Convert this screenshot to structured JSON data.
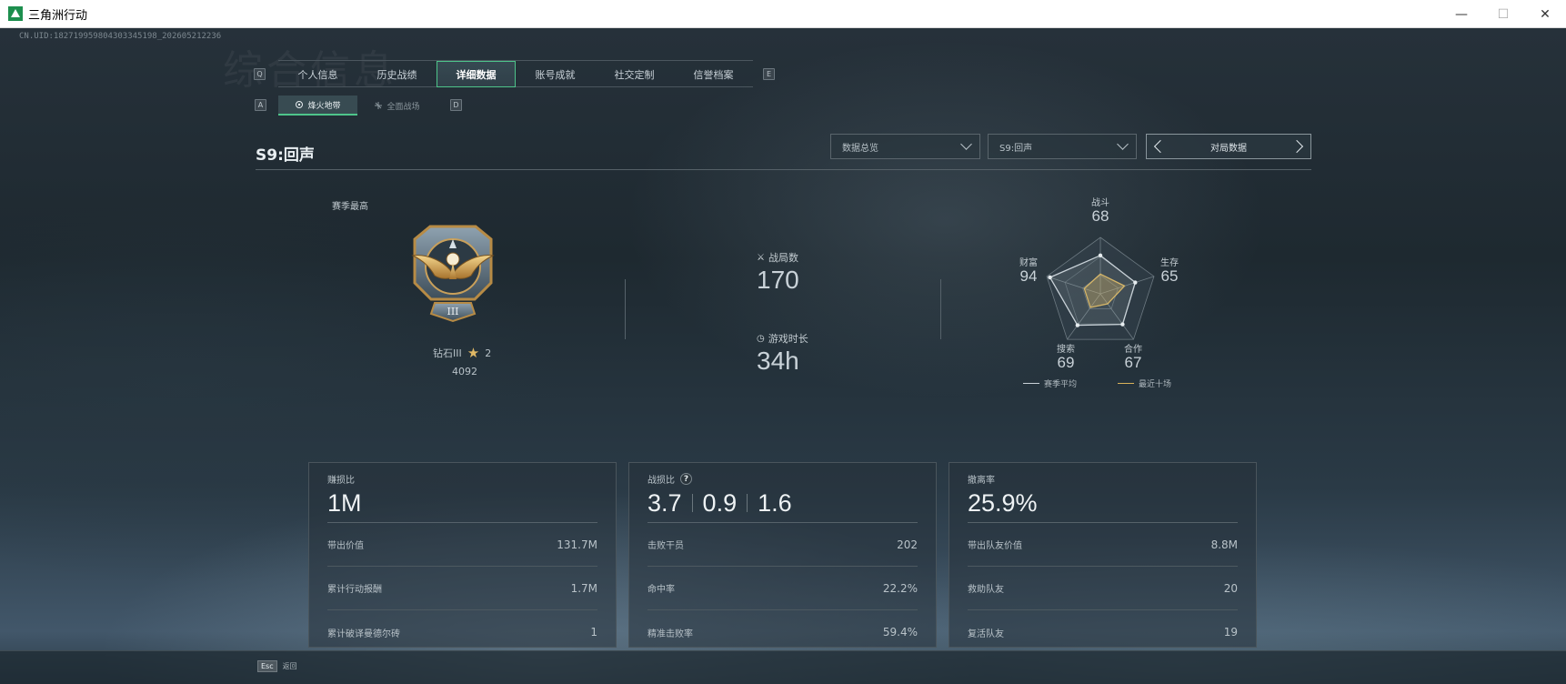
{
  "window": {
    "title": "三角洲行动",
    "minimize": "—",
    "maximize": "☐",
    "close": "✕"
  },
  "uid": "CN.UID:1827199598043033451​98_202605212236",
  "bg_text": "综合信息",
  "tabs": {
    "key_left": "Q",
    "key_right": "E",
    "items": [
      "个人信息",
      "历史战绩",
      "详细数据",
      "账号成就",
      "社交定制",
      "信誉档案"
    ],
    "active": "详细数据"
  },
  "subtabs": {
    "key_left": "A",
    "key_right": "D",
    "items": [
      {
        "label": "烽火地带",
        "icon": "fire-zone-icon"
      },
      {
        "label": "全面战场",
        "icon": "battlefield-icon"
      }
    ],
    "active": "烽火地带"
  },
  "season_title": "S9:回声",
  "dropdowns": {
    "overview": "数据总览",
    "season": "S9:回声"
  },
  "match_nav": {
    "label": "对局数据"
  },
  "rank": {
    "label": "赛季最高",
    "name": "钻石III",
    "stars": "2",
    "points": "4092",
    "badge_numeral": "III"
  },
  "stats": {
    "matches_label": "战局数",
    "matches_value": "170",
    "playtime_label": "游戏时长",
    "playtime_value": "34h"
  },
  "radar": {
    "axes": [
      {
        "label": "战斗",
        "value": "68"
      },
      {
        "label": "生存",
        "value": "65"
      },
      {
        "label": "合作",
        "value": "67"
      },
      {
        "label": "搜索",
        "value": "69"
      },
      {
        "label": "财富",
        "value": "94"
      }
    ],
    "legend_avg": "赛季平均",
    "legend_recent": "最近十场",
    "color_avg": "#c9d2d8",
    "color_recent": "#d9b25a"
  },
  "cards": [
    {
      "title": "赚损比",
      "big": [
        "1M"
      ],
      "rows": [
        {
          "label": "带出价值",
          "value": "131.7M"
        },
        {
          "label": "累计行动报酬",
          "value": "1.7M"
        },
        {
          "label": "累计破译曼德尔砖",
          "value": "1"
        }
      ]
    },
    {
      "title": "战损比",
      "help": "?",
      "big": [
        "3.7",
        "0.9",
        "1.6"
      ],
      "rows": [
        {
          "label": "击败干员",
          "value": "202"
        },
        {
          "label": "命中率",
          "value": "22.2%"
        },
        {
          "label": "精准击败率",
          "value": "59.4%"
        }
      ]
    },
    {
      "title": "撤离率",
      "big": [
        "25.9%"
      ],
      "rows": [
        {
          "label": "带出队友价值",
          "value": "8.8M"
        },
        {
          "label": "救助队友",
          "value": "20"
        },
        {
          "label": "复活队友",
          "value": "19"
        }
      ]
    }
  ],
  "footer": {
    "esc_key": "Esc",
    "esc_label": "返回"
  }
}
